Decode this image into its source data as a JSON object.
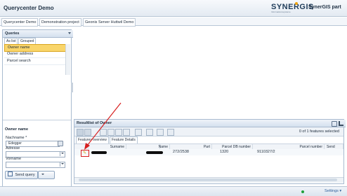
{
  "app": {
    "title": "Querycenter Demo",
    "logo_text": "SYNERGIS",
    "logo_tagline": "Informationssysteme",
    "product_title": "SynerGIS part"
  },
  "tabs": [
    "Querycenter Demo",
    "Demonstration project",
    "Geonis Server Huttwil Demo"
  ],
  "queries_panel": {
    "title": "Queries",
    "subtabs": [
      "As list",
      "Grouped"
    ],
    "items": [
      "Owner name",
      "Owner address",
      "Parcel search"
    ],
    "selected_index": 0
  },
  "form": {
    "section_title": "Owner name",
    "fields": [
      {
        "label": "Nachname *",
        "value": "Edegger"
      },
      {
        "label": "Adresse",
        "value": ""
      },
      {
        "label": "Vorname",
        "value": ""
      }
    ],
    "send_label": "Send query"
  },
  "results": {
    "title": "Resultlist of Owner",
    "count_text": "0 of 1 features selected",
    "tabs": [
      "Features overview",
      "Feature Details"
    ],
    "columns": [
      "Surname",
      "Name",
      "Part",
      "Parcel DB number",
      "Parcel number",
      "Send"
    ],
    "rows": [
      {
        "part": "272/2538",
        "parcel_db": "1320",
        "parcel_number": "9110327/2"
      }
    ]
  },
  "status": {
    "settings_label": "Settings"
  },
  "colors": {
    "accent_selection": "#f9d56a",
    "annotation": "#d71f1f"
  },
  "icons": [
    "collapse-icon",
    "pencil-icon",
    "camera-icon",
    "dropdown-icon"
  ]
}
